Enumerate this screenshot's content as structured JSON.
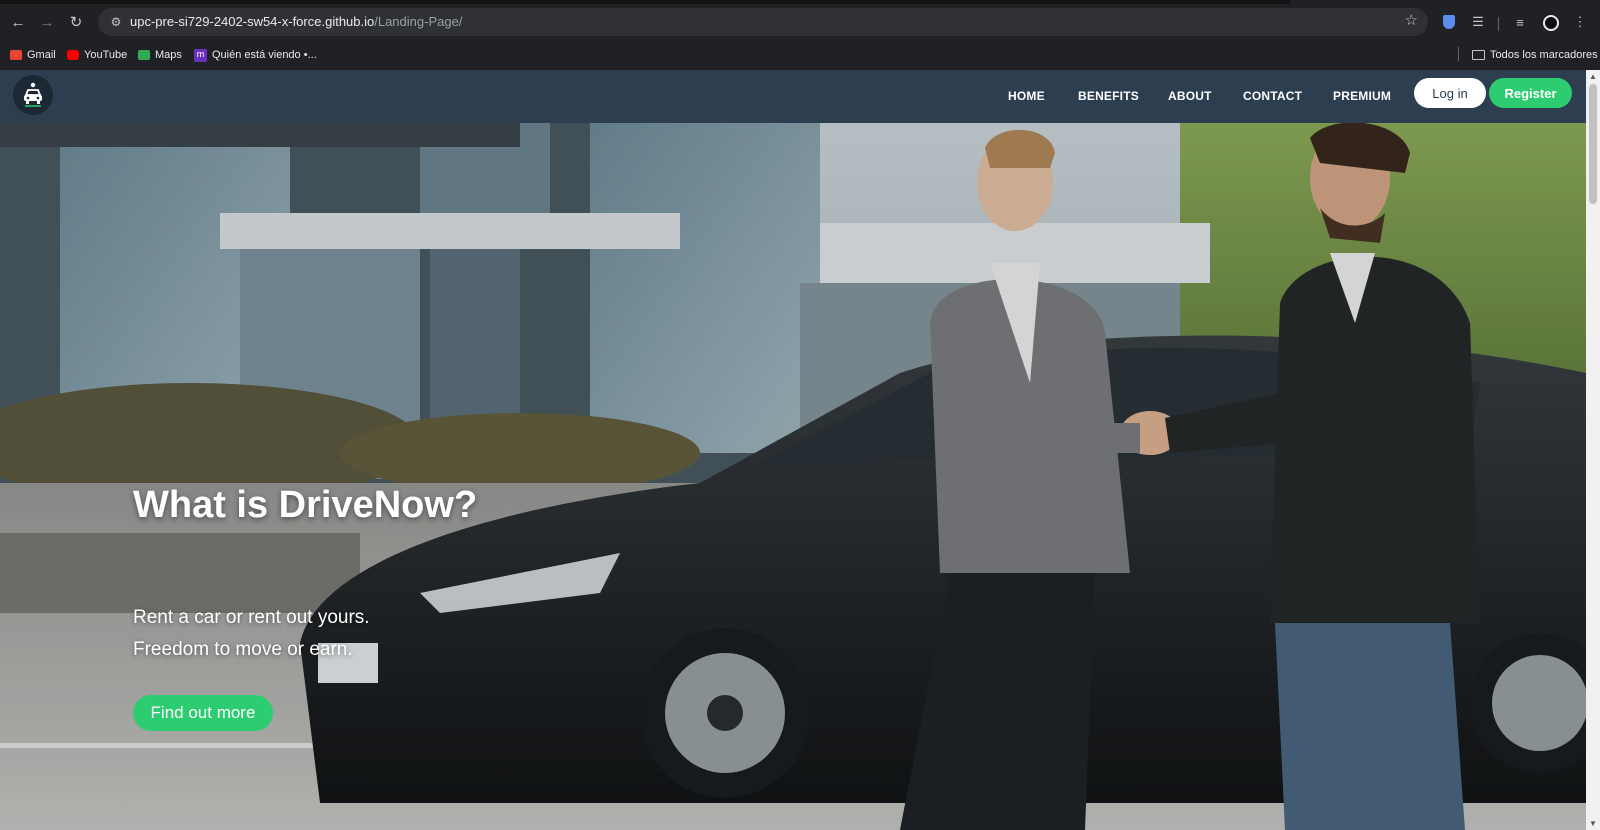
{
  "browser": {
    "url_host": "upc-pre-si729-2402-sw54-x-force.github.io",
    "url_path": "/Landing-Page/",
    "nav_icons": [
      "back-icon",
      "forward-icon",
      "reload-icon",
      "site-info-icon",
      "bookmark-star-icon",
      "extension-icon",
      "puzzle-icon",
      "media-icon",
      "profile-avatar",
      "menu-icon"
    ],
    "bookmarks": [
      {
        "label": "Gmail",
        "icon": "gmail-icon"
      },
      {
        "label": "YouTube",
        "icon": "youtube-icon"
      },
      {
        "label": "Maps",
        "icon": "maps-icon"
      },
      {
        "label": "Quién está viendo •...",
        "icon": "m-icon"
      }
    ],
    "all_bookmarks_label": "Todos los marcadores"
  },
  "navbar": {
    "links": [
      "HOME",
      "BENEFITS",
      "ABOUT",
      "CONTACT",
      "PREMIUM"
    ],
    "login_label": "Log in",
    "register_label": "Register",
    "colors": {
      "bar": "#2c3e50",
      "accent": "#2ecc71"
    }
  },
  "hero": {
    "title": "What is DriveNow?",
    "line1": "Rent a car or rent out yours.",
    "line2": "Freedom to move or earn.",
    "cta_label": "Find out more"
  }
}
